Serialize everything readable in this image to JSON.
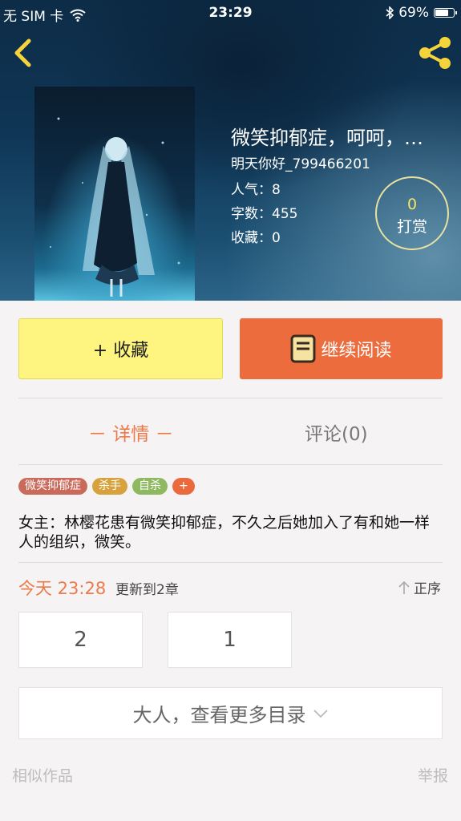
{
  "status_bar": {
    "carrier": "无 SIM 卡",
    "time": "23:29",
    "battery": "69%"
  },
  "book": {
    "title": "微笑抑郁症，呵呵，…",
    "author": "明天你好_799466201",
    "popularity_label": "人气：",
    "popularity": "8",
    "words_label": "字数：",
    "words": "455",
    "favorites_label": "收藏：",
    "favorites": "0"
  },
  "reward": {
    "count": "0",
    "label": "打赏"
  },
  "actions": {
    "collect": "+ 收藏",
    "continue_reading": "继续阅读"
  },
  "tabs": {
    "detail": "－ 详情 －",
    "comments": "评论(0)"
  },
  "tags": [
    {
      "label": "微笑抑郁症",
      "color": "#c96a5a"
    },
    {
      "label": "杀手",
      "color": "#d7a23e"
    },
    {
      "label": "自杀",
      "color": "#8fb960"
    },
    {
      "label": "+",
      "color": "#ea6a3e"
    }
  ],
  "synopsis": "女主：林樱花患有微笑抑郁症，不久之后她加入了有和她一样人的组织，微笑。",
  "update": {
    "time": "今天 23:28",
    "info": "更新到2章",
    "sort": "正序"
  },
  "chapters": [
    "2",
    "1"
  ],
  "more_catalog": "大人，查看更多目录",
  "footer": {
    "similar": "相似作品",
    "report": "举报"
  },
  "colors": {
    "accent_orange": "#ec6c3d",
    "collect_yellow": "#fdf580",
    "share_yellow": "#f5d33a"
  }
}
